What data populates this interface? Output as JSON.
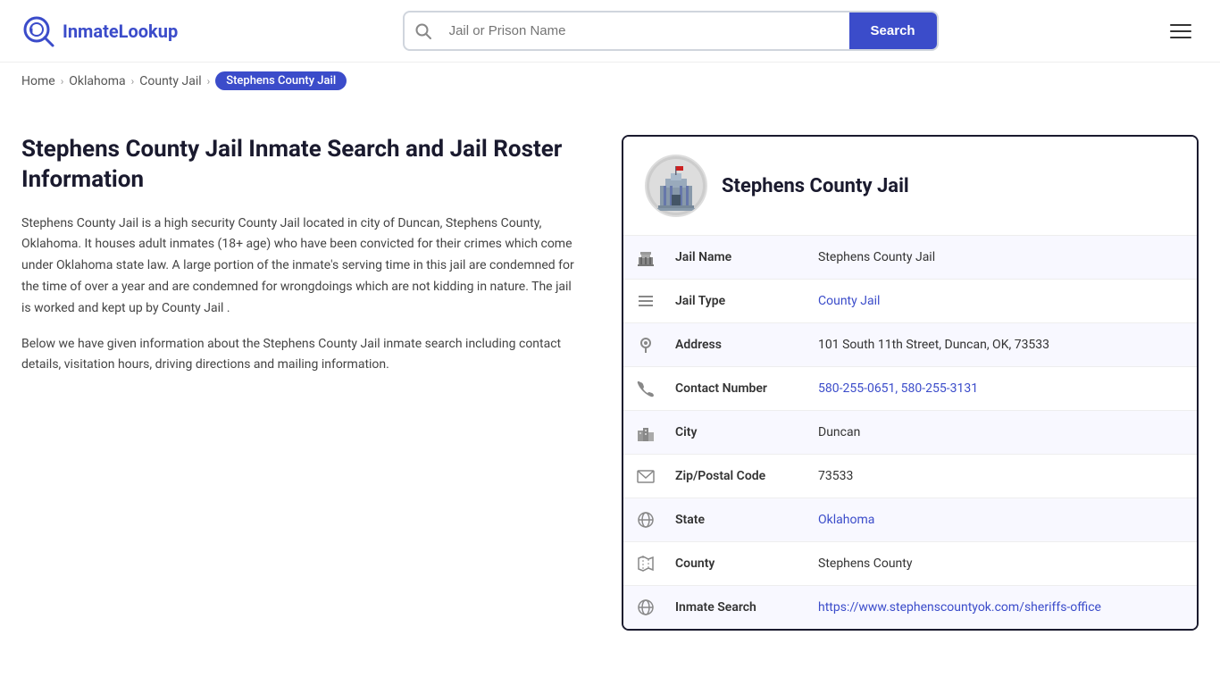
{
  "logo": {
    "text_part1": "Inmate",
    "text_part2": "Lookup",
    "alt": "InmateLookup"
  },
  "search": {
    "placeholder": "Jail or Prison Name",
    "button_label": "Search"
  },
  "breadcrumb": {
    "home": "Home",
    "state": "Oklahoma",
    "type": "County Jail",
    "current": "Stephens County Jail"
  },
  "left": {
    "title": "Stephens County Jail Inmate Search and Jail Roster Information",
    "desc1": "Stephens County Jail is a high security County Jail located in city of Duncan, Stephens County, Oklahoma. It houses adult inmates (18+ age) who have been convicted for their crimes which come under Oklahoma state law. A large portion of the inmate's serving time in this jail are condemned for the time of over a year and are condemned for wrongdoings which are not kidding in nature. The jail is worked and kept up by County Jail .",
    "desc2": "Below we have given information about the Stephens County Jail inmate search including contact details, visitation hours, driving directions and mailing information."
  },
  "card": {
    "name": "Stephens County Jail",
    "rows": [
      {
        "icon": "🏛",
        "label": "Jail Name",
        "value": "Stephens County Jail",
        "link": null
      },
      {
        "icon": "≡",
        "label": "Jail Type",
        "value": "County Jail",
        "link": "#"
      },
      {
        "icon": "📍",
        "label": "Address",
        "value": "101 South 11th Street, Duncan, OK, 73533",
        "link": null
      },
      {
        "icon": "📞",
        "label": "Contact Number",
        "value": "580-255-0651, 580-255-3131",
        "link": "#"
      },
      {
        "icon": "🏙",
        "label": "City",
        "value": "Duncan",
        "link": null
      },
      {
        "icon": "✉",
        "label": "Zip/Postal Code",
        "value": "73533",
        "link": null
      },
      {
        "icon": "🌐",
        "label": "State",
        "value": "Oklahoma",
        "link": "#"
      },
      {
        "icon": "🗺",
        "label": "County",
        "value": "Stephens County",
        "link": null
      },
      {
        "icon": "🌐",
        "label": "Inmate Search",
        "value": "https://www.stephenscountyok.com/sheriffs-office",
        "link": "https://www.stephenscountyok.com/sheriffs-office"
      }
    ]
  }
}
